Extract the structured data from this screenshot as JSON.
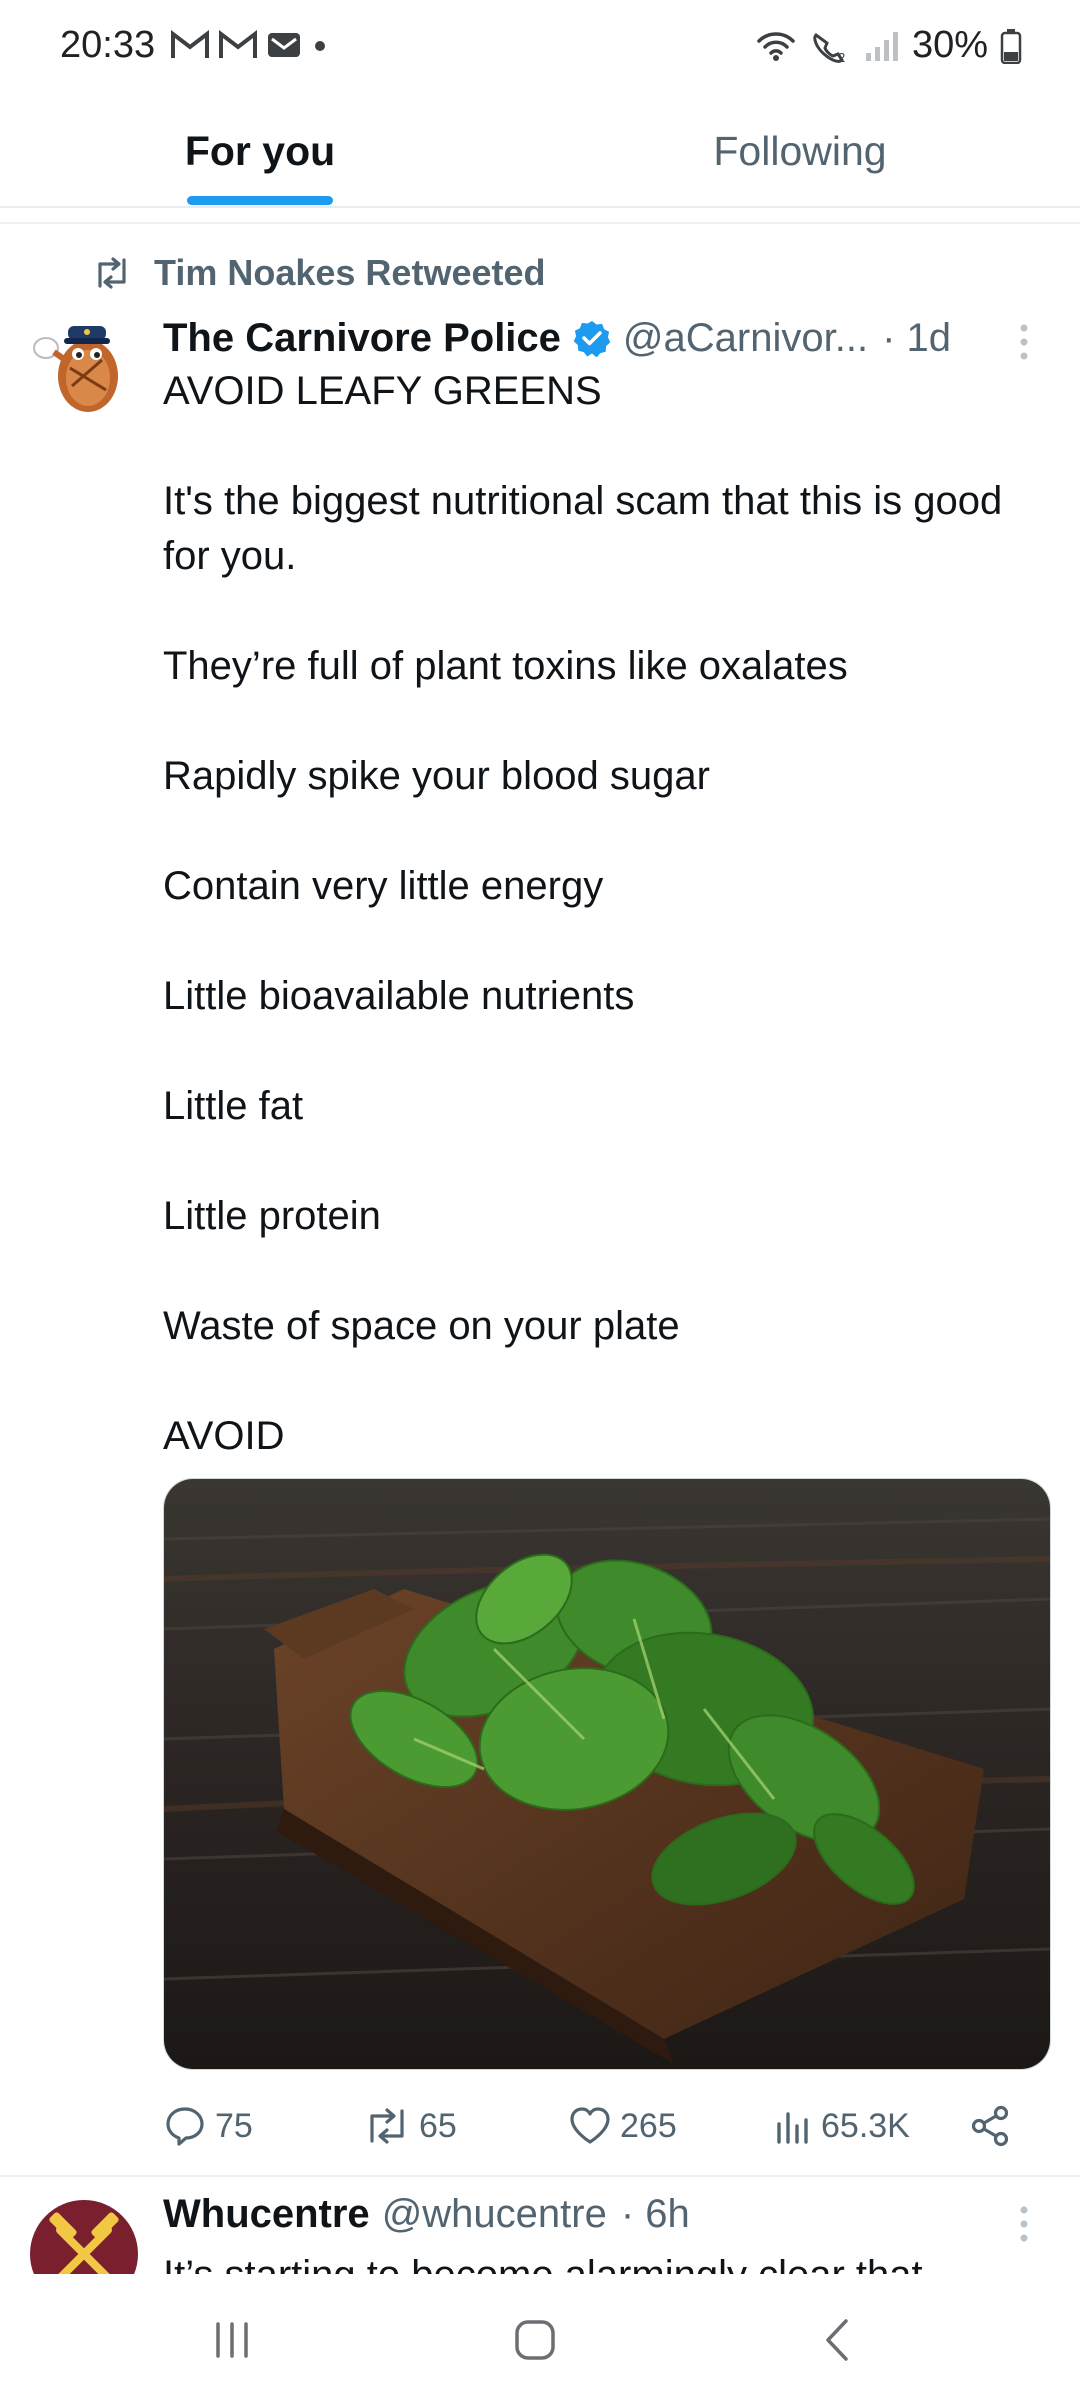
{
  "status_bar": {
    "time": "20:33",
    "battery": "30%",
    "notification_icons": [
      "gmail-icon",
      "gmail-icon",
      "email-icon",
      "dot-icon"
    ],
    "system_icons": [
      "wifi-icon",
      "wifi-calling-icon",
      "signal-icon",
      "battery-icon"
    ]
  },
  "tabs": [
    {
      "label": "For you",
      "selected": true
    },
    {
      "label": "Following",
      "selected": false
    }
  ],
  "tweet1": {
    "retweet_label": "Tim Noakes Retweeted",
    "display_name": "The Carnivore Police",
    "verified": true,
    "handle": "@aCarnivor...",
    "time": "· 1d",
    "text": [
      "AVOID LEAFY GREENS",
      "It's the biggest nutritional scam that this is good for you.",
      "They’re full of plant toxins like oxalates",
      "Rapidly spike your blood sugar",
      "Contain very little energy",
      "Little bioavailable nutrients",
      "Little fat",
      "Little protein",
      "Waste of space on your plate",
      "AVOID"
    ],
    "media_icon": "spinach-on-cutting-board-image",
    "replies": "75",
    "retweets": "65",
    "likes": "265",
    "views": "65.3K"
  },
  "tweet2": {
    "display_name": "Whucentre",
    "handle": "@whucentre",
    "time": "· 6h",
    "text_partial": "It’s starting to become alarmingly clear that"
  },
  "colors": {
    "accent": "#1d9bf0",
    "secondary_text": "#536471",
    "primary_text": "#0f1419"
  }
}
